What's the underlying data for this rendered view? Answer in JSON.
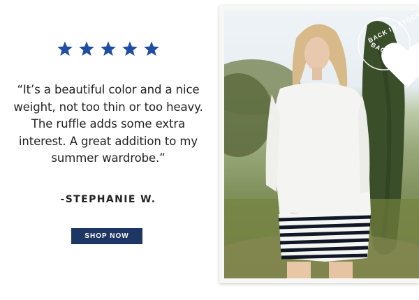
{
  "review": {
    "rating": 5,
    "rating_max": 5,
    "quote": "“It’s a beautiful color and a nice weight, not too thin or too heavy. The ruffle adds some extra interest. A great addition to my summer wardrobe.”",
    "author": "-STEPHANIE W."
  },
  "cta": {
    "label": "SHOP NOW"
  },
  "badge": {
    "text_top": "BACK IN STOCK",
    "text_bottom": "BACK IN STOCK",
    "icon": "heart-icon"
  },
  "photo": {
    "subject": "woman in white long-sleeve top and navy striped shorts"
  },
  "colors": {
    "star": "#1f4ea3",
    "button": "#1e3663",
    "text": "#222222"
  }
}
